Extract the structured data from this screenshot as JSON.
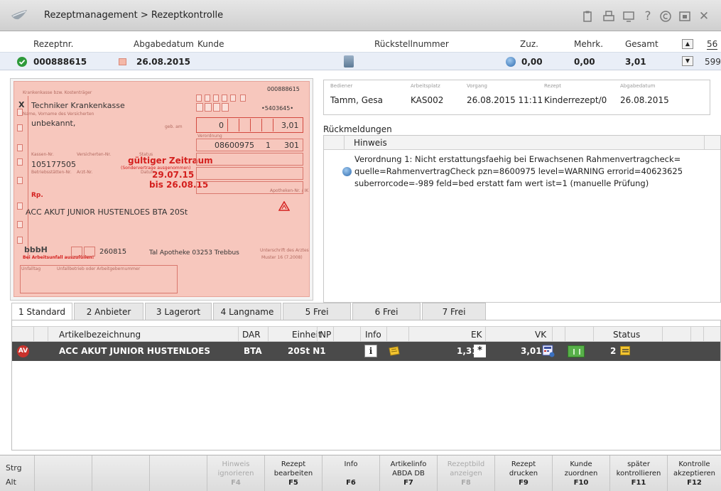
{
  "window": {
    "title": "Rezeptmanagement > Rezeptkontrolle"
  },
  "header": {
    "col_rezeptnr": "Rezeptnr.",
    "col_abgabedatum": "Abgabedatum",
    "col_kunde": "Kunde",
    "col_rueckstellnummer": "Rückstellnummer",
    "col_zuz": "Zuz.",
    "col_mehrk": "Mehrk.",
    "col_gesamt": "Gesamt",
    "counter_top": "56",
    "counter_bottom": "599"
  },
  "record": {
    "rezeptnr": "000888615",
    "abgabedatum": "26.08.2015",
    "zuz": "0,00",
    "mehrk": "0,00",
    "gesamt": "3,01"
  },
  "form": {
    "number": "000888615",
    "kasse": "Techniker Krankenkasse",
    "kassen_nr": "•5403645•",
    "name": "unbekannt,",
    "betrag": "3,01",
    "zuzahl": "0",
    "pzn": "08600975",
    "menge": "1",
    "faktor": "301",
    "kassennr": "105177505",
    "gueltig_label": "gültiger Zeitraum",
    "gueltig_sub": "(Sondervertrage ausgenommen)",
    "datum_label": "Datum",
    "von": "29.07.15",
    "bis": "bis 26.08.15",
    "rp": "Rp.",
    "artikel": "ACC AKUT JUNIOR HUSTENLOES BTA 20St",
    "code": "260815",
    "apotheke": "Tal Apotheke 03253 Trebbus",
    "sig": "bbbH",
    "kasse_label": "Krankenkasse bzw. Kostenträger",
    "name_label": "Name, Vorname des Versicherten",
    "geb_label": "geb. am",
    "kostentraeger_label": "Kassen-Nr.",
    "versicherten_label": "Versicherten-Nr.",
    "status_label": "Status",
    "betriebs_label": "Betriebsstätten-Nr.",
    "arzt_label": "Arzt-Nr.",
    "unfall_label": "Unfalltag",
    "arbeitgeber_label": "Unfallbetrieb oder Arbeitgebernummer",
    "verordnung_label": "Verordnung",
    "apotheken_label": "Apotheken-Nr. / IK",
    "unterschrift_label": "Unterschrift des Arztes",
    "muster_label": "Muster 16 (7.2008)",
    "bei_label": "Bei Arbeitsunfall auszufüllen!"
  },
  "info": {
    "bediener_label": "Bediener",
    "bediener": "Tamm, Gesa",
    "arbeitsplatz_label": "Arbeitsplatz",
    "arbeitsplatz": "KAS002",
    "vorgang_label": "Vorgang",
    "vorgang": "26.08.2015 11:11",
    "rezept_label": "Rezept",
    "rezept": "Kinderrezept/0",
    "abgabedatum_label": "Abgabedatum",
    "abgabedatum": "26.08.2015"
  },
  "rueckmeldungen": {
    "title": "Rückmeldungen",
    "col_hinweis": "Hinweis",
    "line1": "Verordnung 1: Nicht erstattungsfaehig bei Erwachsenen Rahmenvertragcheck=",
    "line2": "quelle=RahmenvertragCheck pzn=8600975 level=WARNING errorid=40623625",
    "line3": "suberrorcode=-989 feld=bed erstatt fam wert ist=1 (manuelle Prüfung)"
  },
  "tabs": [
    {
      "label": "1 Standard"
    },
    {
      "label": "2 Anbieter"
    },
    {
      "label": "3 Lagerort"
    },
    {
      "label": "4 Langname"
    },
    {
      "label": "5 Frei"
    },
    {
      "label": "6 Frei"
    },
    {
      "label": "7 Frei"
    }
  ],
  "table": {
    "columns": {
      "artikel": "Artikelbezeichnung",
      "dar": "DAR",
      "einheit": "Einheit",
      "np": "NP",
      "info": "Info",
      "ek": "EK",
      "vk": "VK",
      "status": "Status"
    },
    "row": {
      "badge": "AV",
      "artikel": "ACC AKUT JUNIOR HUSTENLOES",
      "dar": "BTA",
      "einheit": "20St N1",
      "ek": "1,31",
      "ek_mark": "*",
      "vk": "3,01",
      "status": "2"
    }
  },
  "footer": {
    "mod1": "Strg",
    "mod2": "Alt",
    "keys": [
      {
        "l1": "Hinweis",
        "l2": "ignorieren",
        "k": "F4",
        "disabled": true
      },
      {
        "l1": "Rezept",
        "l2": "bearbeiten",
        "k": "F5",
        "disabled": false
      },
      {
        "l1": "Info",
        "l2": "",
        "k": "F6",
        "disabled": false
      },
      {
        "l1": "Artikelinfo",
        "l2": "ABDA DB",
        "k": "F7",
        "disabled": false
      },
      {
        "l1": "Rezeptbild",
        "l2": "anzeigen",
        "k": "F8",
        "disabled": true
      },
      {
        "l1": "Rezept",
        "l2": "drucken",
        "k": "F9",
        "disabled": false
      },
      {
        "l1": "Kunde",
        "l2": "zuordnen",
        "k": "F10",
        "disabled": false
      },
      {
        "l1": "später",
        "l2": "kontrollieren",
        "k": "F11",
        "disabled": false
      },
      {
        "l1": "Kontrolle",
        "l2": "akzeptieren",
        "k": "F12",
        "disabled": false
      }
    ]
  },
  "colors": {
    "accent_green": "#2e9a3a",
    "row_dark": "#4a4a4a",
    "badge_red": "#c8322c",
    "form_pink": "#f7c7bd"
  }
}
